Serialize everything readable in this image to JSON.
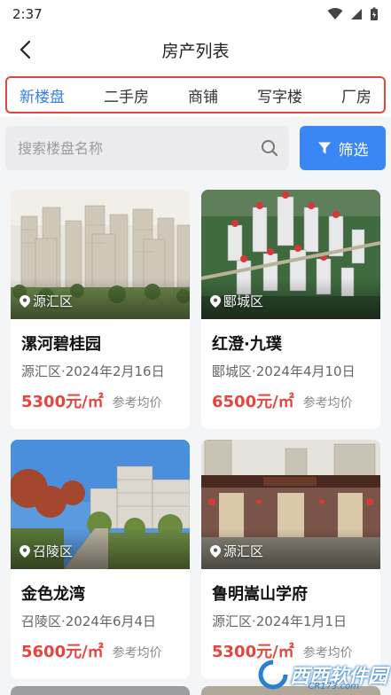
{
  "status": {
    "time": "2:37"
  },
  "header": {
    "title": "房产列表"
  },
  "tabs": [
    {
      "label": "新楼盘",
      "active": true
    },
    {
      "label": "二手房",
      "active": false
    },
    {
      "label": "商铺",
      "active": false
    },
    {
      "label": "写字楼",
      "active": false
    },
    {
      "label": "厂房",
      "active": false
    }
  ],
  "search": {
    "placeholder": "搜索楼盘名称",
    "filter_label": "筛选"
  },
  "accent_color": "#3a86f5",
  "price_color": "#e2463f",
  "listings": [
    {
      "district": "源汇区",
      "name": "漯河碧桂园",
      "date": "源汇区·2024年2月16日",
      "price": "5300元/㎡",
      "price_note": "参考均价"
    },
    {
      "district": "郾城区",
      "name": "红澄·九璞",
      "date": "郾城区·2024年4月10日",
      "price": "6500元/㎡",
      "price_note": "参考均价"
    },
    {
      "district": "召陵区",
      "name": "金色龙湾",
      "date": "召陵区·2024年6月4日",
      "price": "5600元/㎡",
      "price_note": "参考均价"
    },
    {
      "district": "源汇区",
      "name": "鲁明嵩山学府",
      "date": "源汇区·2024年1月1日",
      "price": "5300元/㎡",
      "price_note": "参考均价"
    }
  ],
  "watermark": {
    "text": "西西软件园",
    "sub": "CR173.com"
  }
}
